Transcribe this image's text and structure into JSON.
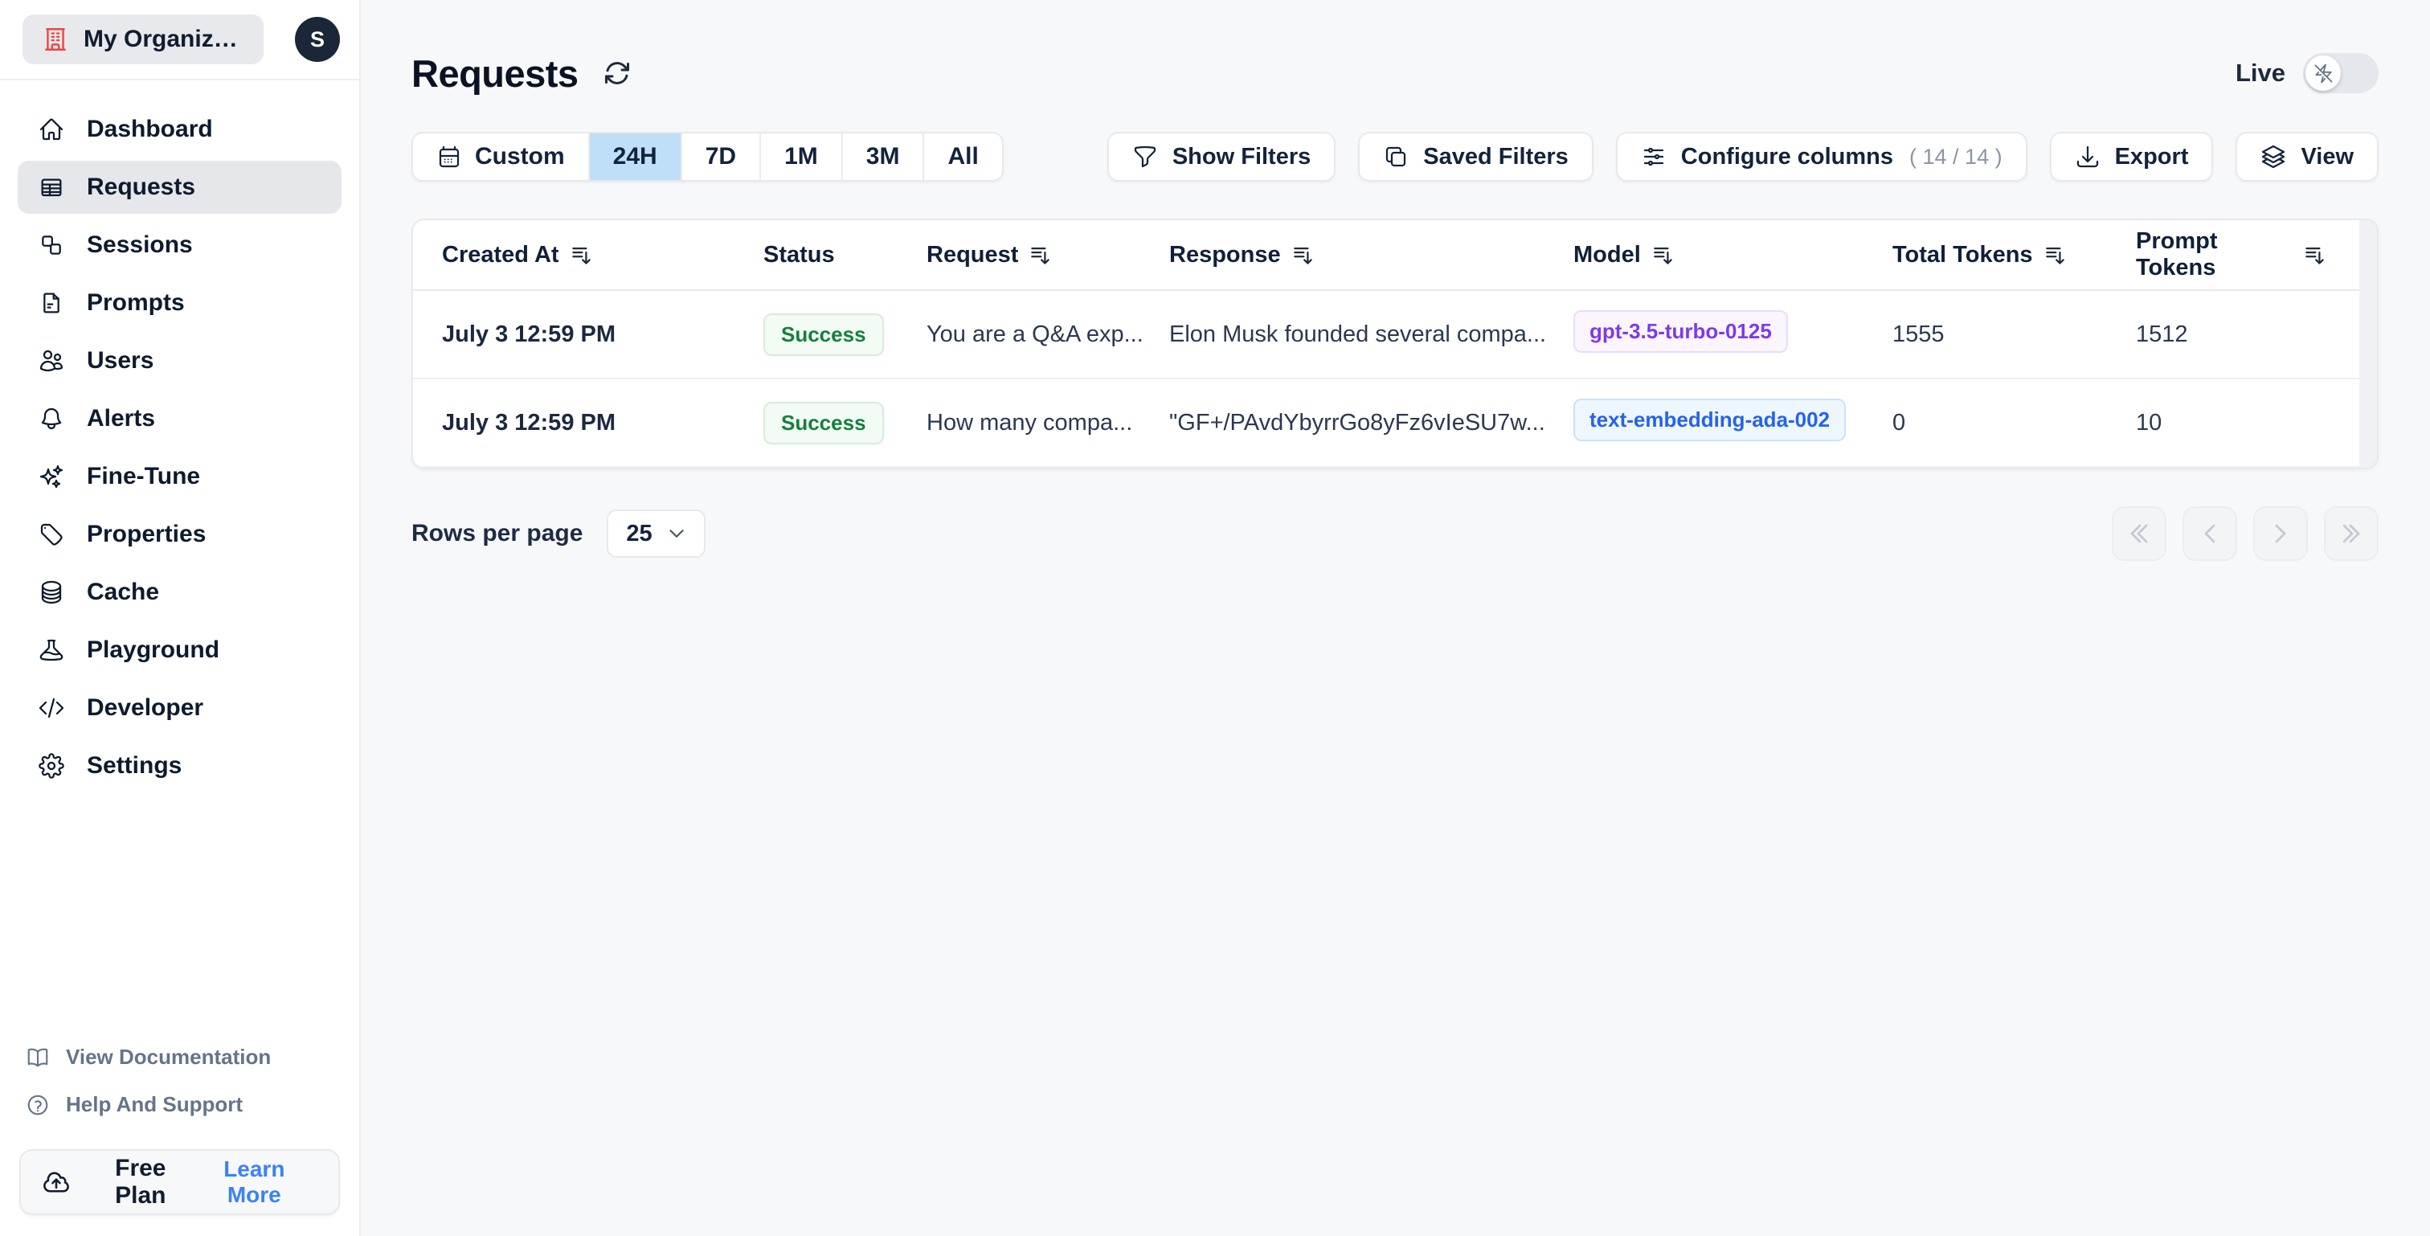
{
  "org": {
    "name": "My Organizatio...",
    "avatar_initial": "S"
  },
  "sidebar": {
    "items": [
      {
        "label": "Dashboard",
        "icon": "home-icon",
        "active": false
      },
      {
        "label": "Requests",
        "icon": "table-icon",
        "active": true
      },
      {
        "label": "Sessions",
        "icon": "squares-icon",
        "active": false
      },
      {
        "label": "Prompts",
        "icon": "document-icon",
        "active": false
      },
      {
        "label": "Users",
        "icon": "users-icon",
        "active": false
      },
      {
        "label": "Alerts",
        "icon": "bell-icon",
        "active": false
      },
      {
        "label": "Fine-Tune",
        "icon": "sparkles-icon",
        "active": false
      },
      {
        "label": "Properties",
        "icon": "tag-icon",
        "active": false
      },
      {
        "label": "Cache",
        "icon": "database-icon",
        "active": false
      },
      {
        "label": "Playground",
        "icon": "beaker-icon",
        "active": false
      },
      {
        "label": "Developer",
        "icon": "code-icon",
        "active": false
      },
      {
        "label": "Settings",
        "icon": "gear-icon",
        "active": false
      }
    ],
    "footer_links": [
      {
        "label": "View Documentation",
        "icon": "book-open-icon"
      },
      {
        "label": "Help And Support",
        "icon": "question-circle-icon"
      }
    ],
    "plan": {
      "label": "Free Plan",
      "cta": "Learn More"
    }
  },
  "header": {
    "title": "Requests",
    "live_label": "Live"
  },
  "toolbar": {
    "time_ranges": [
      {
        "label": "Custom",
        "selected": false
      },
      {
        "label": "24H",
        "selected": true
      },
      {
        "label": "7D",
        "selected": false
      },
      {
        "label": "1M",
        "selected": false
      },
      {
        "label": "3M",
        "selected": false
      },
      {
        "label": "All",
        "selected": false
      }
    ],
    "show_filters_label": "Show Filters",
    "saved_filters_label": "Saved Filters",
    "configure_columns_label": "Configure columns",
    "configure_columns_count": "( 14 / 14 )",
    "export_label": "Export",
    "view_label": "View"
  },
  "table": {
    "columns": [
      {
        "label": "Created At",
        "sortable": true
      },
      {
        "label": "Status",
        "sortable": false
      },
      {
        "label": "Request",
        "sortable": true
      },
      {
        "label": "Response",
        "sortable": true
      },
      {
        "label": "Model",
        "sortable": true
      },
      {
        "label": "Total Tokens",
        "sortable": true
      },
      {
        "label": "Prompt Tokens",
        "sortable": true
      }
    ],
    "rows": [
      {
        "created_at": "July 3 12:59 PM",
        "status": "Success",
        "request": "You are a Q&A exp...",
        "response": "Elon Musk founded several compa...",
        "model": "gpt-3.5-turbo-0125",
        "model_color": "badge-purple",
        "total_tokens": "1555",
        "prompt_tokens": "1512"
      },
      {
        "created_at": "July 3 12:59 PM",
        "status": "Success",
        "request": "How many compa...",
        "response": "\"GF+/PAvdYbyrrGo8yFz6vIeSU7w...",
        "model": "text-embedding-ada-002",
        "model_color": "badge-blue",
        "total_tokens": "0",
        "prompt_tokens": "10"
      }
    ]
  },
  "pagination": {
    "rows_per_page_label": "Rows per page",
    "rows_per_page_value": "25"
  },
  "colors": {
    "accent_blue": "#3b82f6",
    "selected_range_bg": "#bedff7",
    "success_green": "#15803d",
    "model_purple": "#7c3aed",
    "model_blue": "#2563eb",
    "org_icon_red": "#ef4444",
    "sidebar_active_bg": "#e5e7ea"
  }
}
